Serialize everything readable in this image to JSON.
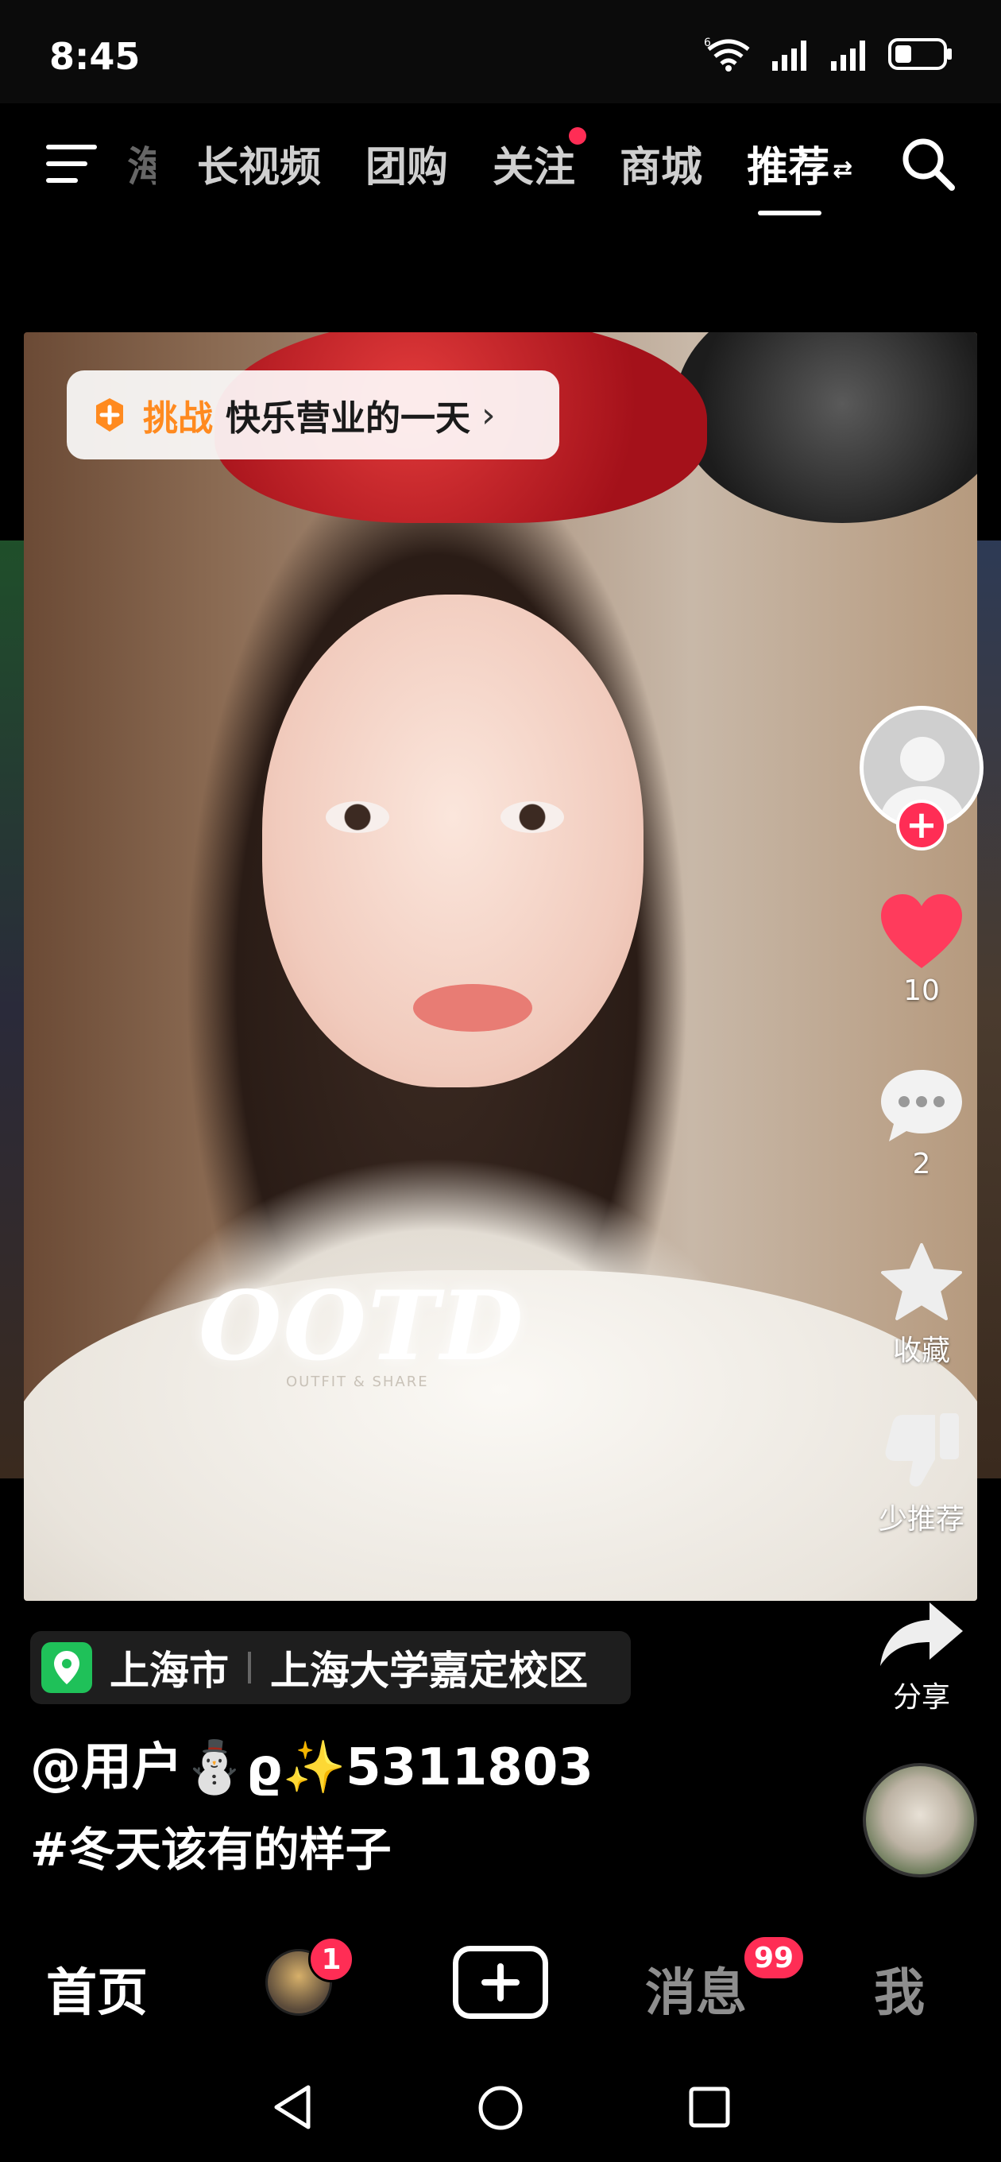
{
  "status_bar": {
    "time": "8:45",
    "wifi_badge": "6"
  },
  "top_nav": {
    "tabs": [
      {
        "label": "海",
        "state": "faded"
      },
      {
        "label": "长视频",
        "state": "normal"
      },
      {
        "label": "团购",
        "state": "normal"
      },
      {
        "label": "关注",
        "state": "normal",
        "dot": true
      },
      {
        "label": "商城",
        "state": "normal"
      },
      {
        "label": "推荐",
        "state": "active"
      }
    ],
    "swap_glyph": "⇄"
  },
  "video": {
    "challenge": {
      "type": "挑战",
      "title": "快乐营业的一天",
      "chevron": "›"
    },
    "overlay_text": "OOTD",
    "overlay_subtext": "OUTFIT & SHARE"
  },
  "actions": {
    "follow_glyph": "+",
    "like_count": "10",
    "comment_count": "2",
    "favorite_label": "收藏",
    "not_interested_label": "少推荐",
    "share_label": "分享"
  },
  "post": {
    "location_city": "上海市",
    "location_place": "上海大学嘉定校区",
    "username": "@用户⛄ϱ✨5311803",
    "hashtag": "#冬天该有的样子"
  },
  "bottom_nav": {
    "home": "首页",
    "friends_badge": "1",
    "messages": "消息",
    "messages_badge": "99",
    "me": "我"
  },
  "colors": {
    "accent": "#ff2d55",
    "like": "#ff3b5c",
    "challenge_orange": "#ff8a1f",
    "location_green": "#1fc159"
  },
  "icons": {
    "menu": "menu-icon",
    "search": "search-icon",
    "like": "heart-icon",
    "comment": "comment-icon",
    "favorite": "star-icon",
    "not_interested": "thumbs-down-icon",
    "share": "share-arrow-icon",
    "location": "location-pin-icon",
    "create": "plus-square-icon",
    "back": "back-triangle-icon",
    "home": "home-circle-icon",
    "recents": "recents-square-icon"
  }
}
